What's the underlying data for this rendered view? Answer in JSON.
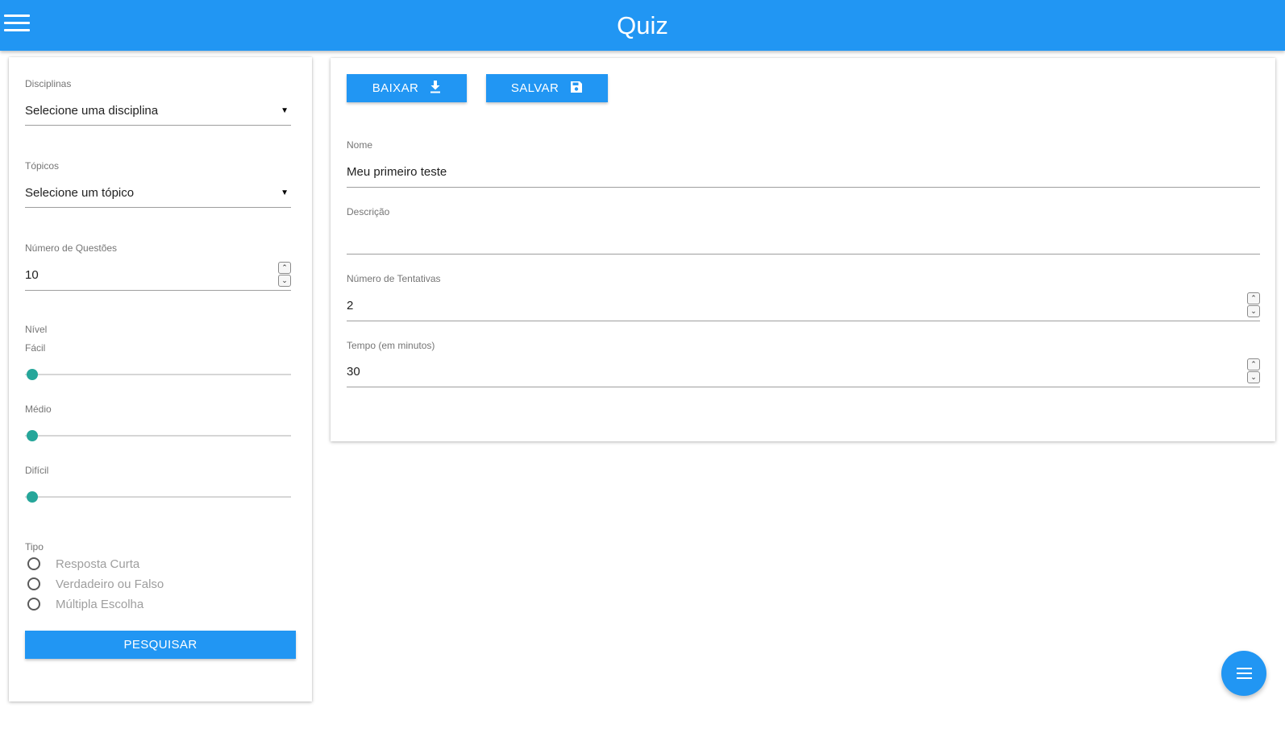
{
  "header": {
    "title": "Quiz",
    "menu_icon": "hamburger-icon"
  },
  "filters": {
    "disciplinas": {
      "label": "Disciplinas",
      "value": "Selecione uma disciplina"
    },
    "topicos": {
      "label": "Tópicos",
      "value": "Selecione um tópico"
    },
    "num_questoes": {
      "label": "Número de Questões",
      "value": "10"
    },
    "nivel": {
      "label": "Nível",
      "levels": [
        {
          "label": "Fácil",
          "value": 0
        },
        {
          "label": "Médio",
          "value": 0
        },
        {
          "label": "Difícil",
          "value": 0
        }
      ]
    },
    "tipo": {
      "label": "Tipo",
      "options": [
        "Resposta Curta",
        "Verdadeiro ou Falso",
        "Múltipla Escolha"
      ],
      "selected": null
    },
    "search_button": "PESQUISAR"
  },
  "quiz_form": {
    "download_button": "BAIXAR",
    "save_button": "SALVAR",
    "nome": {
      "label": "Nome",
      "value": "Meu primeiro teste"
    },
    "descricao": {
      "label": "Descrição",
      "value": ""
    },
    "tentativas": {
      "label": "Número de Tentativas",
      "value": "2"
    },
    "tempo": {
      "label": "Tempo (em minutos)",
      "value": "30"
    }
  },
  "fab": {
    "icon": "list-icon"
  },
  "colors": {
    "primary": "#2196f3",
    "slider": "#26a69a"
  }
}
